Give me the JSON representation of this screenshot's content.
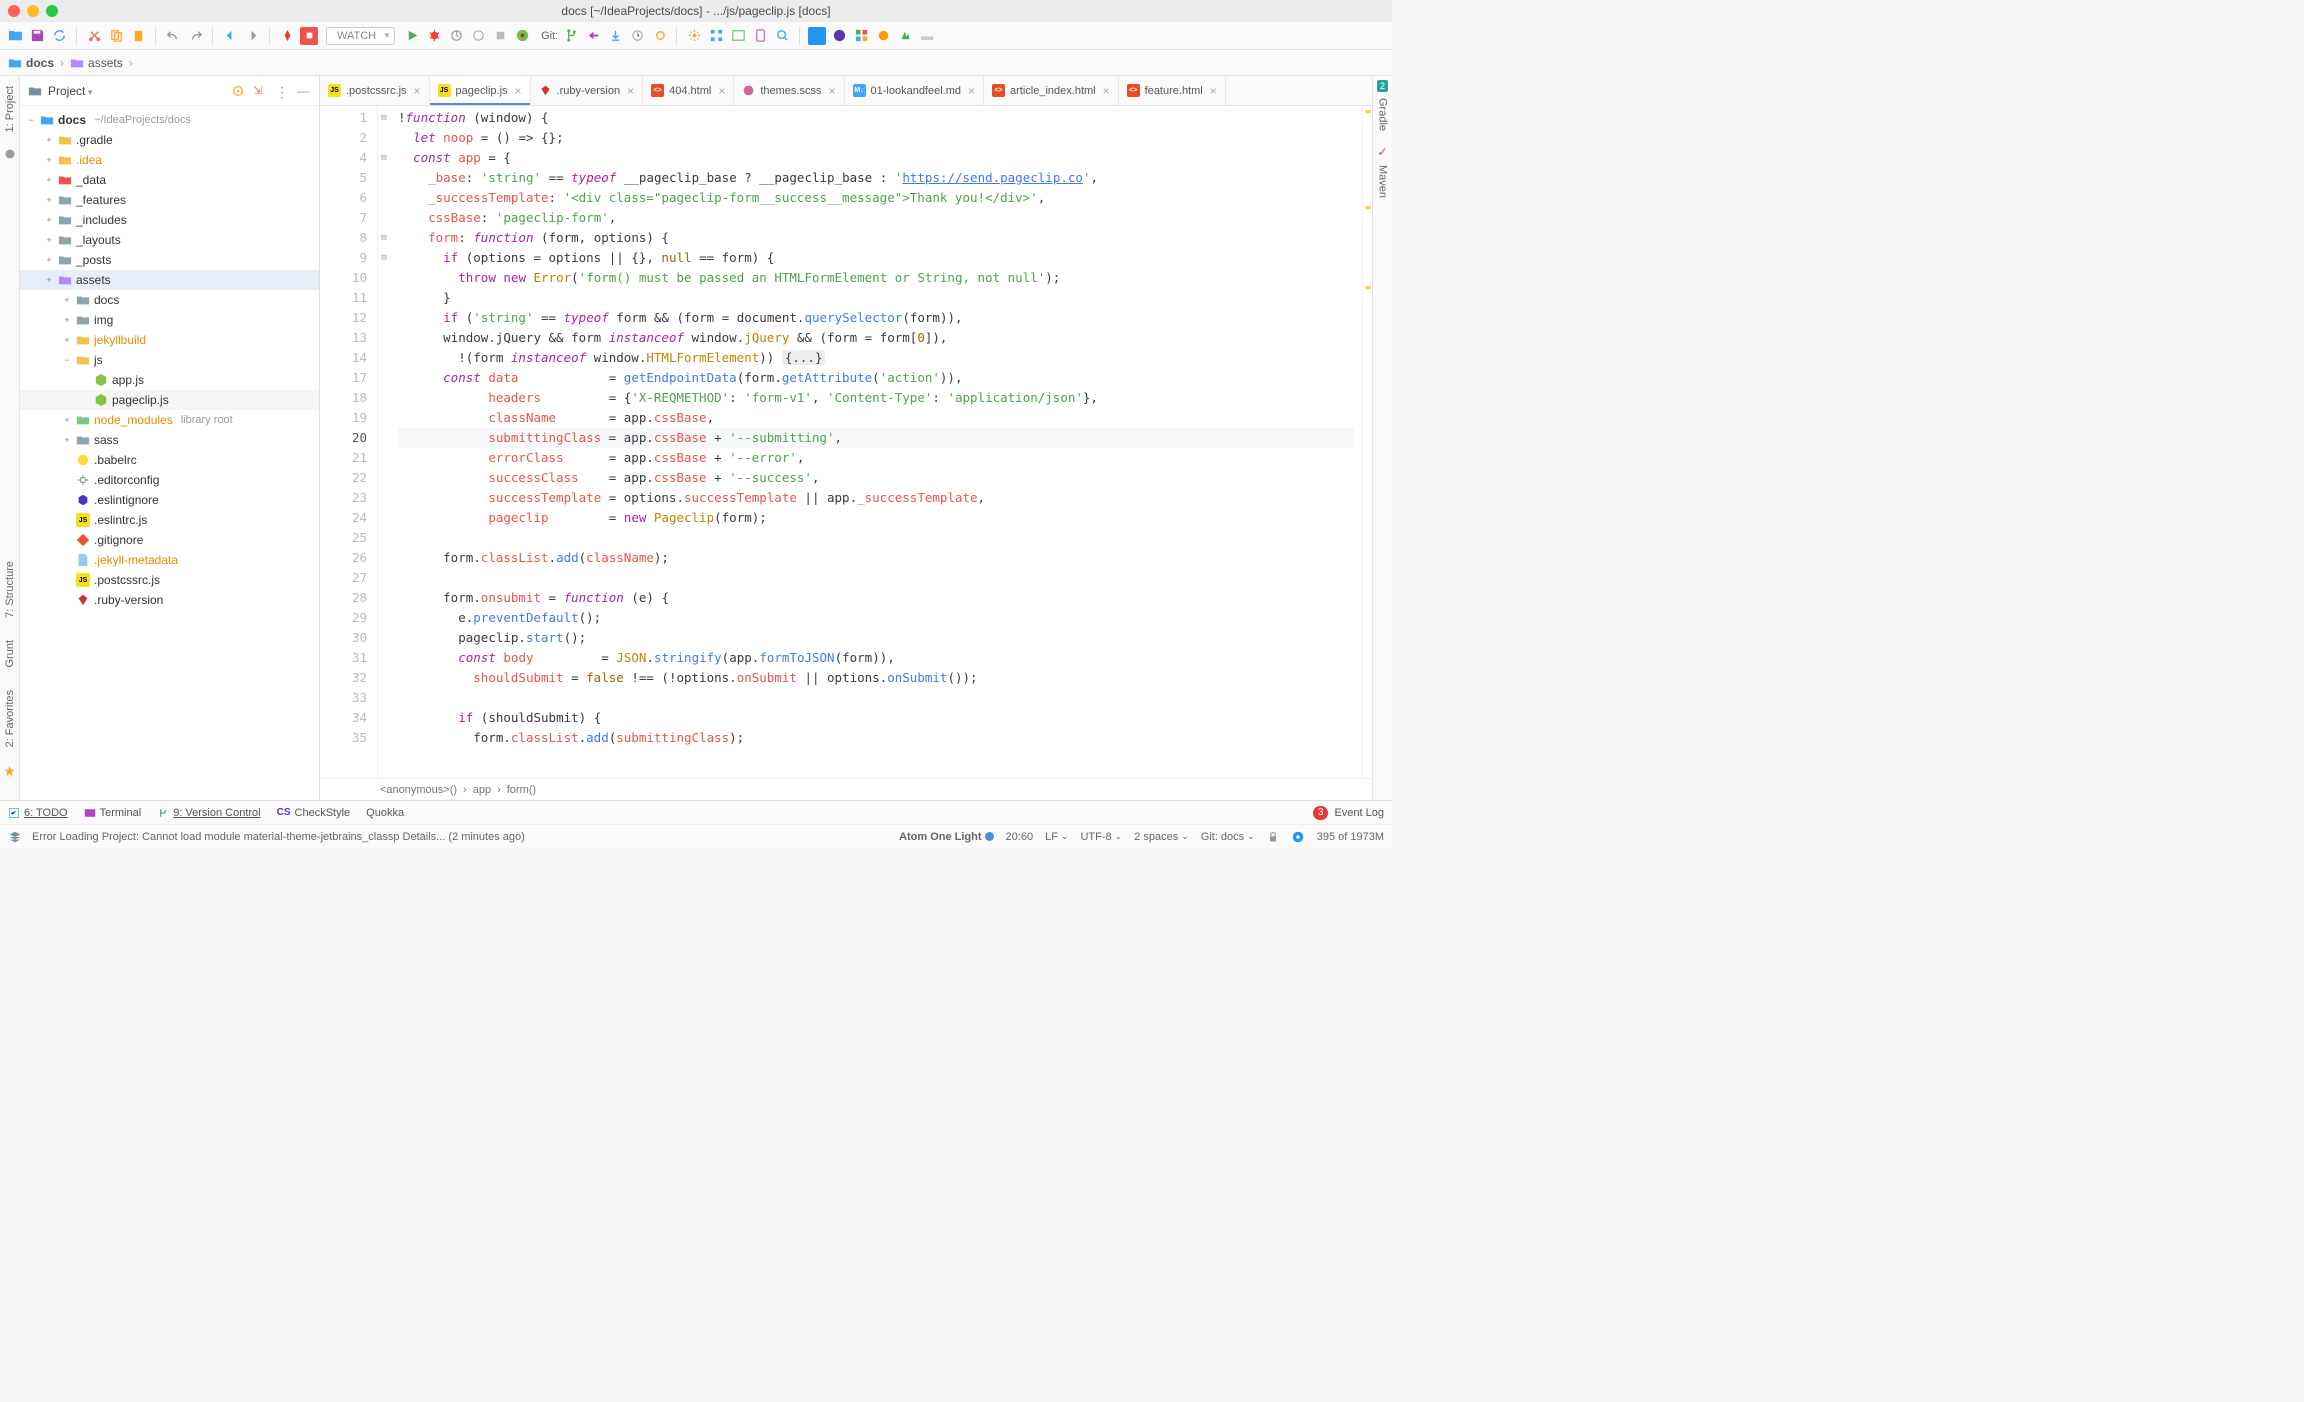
{
  "title": "docs [~/IdeaProjects/docs] - .../js/pageclip.js [docs]",
  "watch_label": "WATCH",
  "git_label": "Git:",
  "breadcrumb": [
    {
      "icon": "folder",
      "label": "docs"
    },
    {
      "icon": "folder-p",
      "label": "assets"
    }
  ],
  "sidebar": {
    "title": "Project",
    "root": {
      "label": "docs",
      "hint": "~/IdeaProjects/docs"
    },
    "items": [
      {
        "indent": 1,
        "arrow": "+",
        "ico": "folder-y",
        "label": ".gradle"
      },
      {
        "indent": 1,
        "arrow": "+",
        "ico": "folder-y",
        "label": ".idea",
        "orange": true
      },
      {
        "indent": 1,
        "arrow": "+",
        "ico": "folder-r",
        "label": "_data"
      },
      {
        "indent": 1,
        "arrow": "+",
        "ico": "folder",
        "label": "_features"
      },
      {
        "indent": 1,
        "arrow": "+",
        "ico": "folder",
        "label": "_includes"
      },
      {
        "indent": 1,
        "arrow": "+",
        "ico": "folder",
        "label": "_layouts"
      },
      {
        "indent": 1,
        "arrow": "+",
        "ico": "folder",
        "label": "_posts"
      },
      {
        "indent": 1,
        "arrow": "+",
        "ico": "folder-p",
        "label": "assets",
        "sel": true
      },
      {
        "indent": 2,
        "arrow": "+",
        "ico": "folder",
        "label": "docs"
      },
      {
        "indent": 2,
        "arrow": "+",
        "ico": "folder",
        "label": "img"
      },
      {
        "indent": 2,
        "arrow": "+",
        "ico": "folder-y",
        "label": "jekyllbuild",
        "orange": true
      },
      {
        "indent": 2,
        "arrow": "−",
        "ico": "folder-y",
        "label": "js"
      },
      {
        "indent": 3,
        "arrow": "",
        "ico": "node",
        "label": "app.js"
      },
      {
        "indent": 3,
        "arrow": "",
        "ico": "node",
        "label": "pageclip.js",
        "sel2": true
      },
      {
        "indent": 2,
        "arrow": "+",
        "ico": "folder-g",
        "label": "node_modules",
        "hint": "library root",
        "orange": true
      },
      {
        "indent": 2,
        "arrow": "+",
        "ico": "folder",
        "label": "sass"
      },
      {
        "indent": 2,
        "arrow": "",
        "ico": "babel",
        "label": ".babelrc"
      },
      {
        "indent": 2,
        "arrow": "",
        "ico": "gear",
        "label": ".editorconfig"
      },
      {
        "indent": 2,
        "arrow": "",
        "ico": "eslint",
        "label": ".eslintignore"
      },
      {
        "indent": 2,
        "arrow": "",
        "ico": "js",
        "label": ".eslintrc.js"
      },
      {
        "indent": 2,
        "arrow": "",
        "ico": "git",
        "label": ".gitignore"
      },
      {
        "indent": 2,
        "arrow": "",
        "ico": "file",
        "label": ".jekyll-metadata",
        "orange": true
      },
      {
        "indent": 2,
        "arrow": "",
        "ico": "js",
        "label": ".postcssrc.js"
      },
      {
        "indent": 2,
        "arrow": "",
        "ico": "ruby",
        "label": ".ruby-version"
      }
    ]
  },
  "tabs": [
    {
      "ico": "js",
      "label": ".postcssrc.js"
    },
    {
      "ico": "js",
      "label": "pageclip.js",
      "active": true
    },
    {
      "ico": "ruby",
      "label": ".ruby-version"
    },
    {
      "ico": "html",
      "label": "404.html"
    },
    {
      "ico": "sass",
      "label": "themes.scss"
    },
    {
      "ico": "md",
      "label": "01-lookandfeel.md"
    },
    {
      "ico": "html",
      "label": "article_index.html"
    },
    {
      "ico": "html",
      "label": "feature.html"
    }
  ],
  "code": {
    "lines": [
      1,
      2,
      4,
      5,
      6,
      7,
      8,
      9,
      10,
      11,
      12,
      13,
      14,
      17,
      18,
      19,
      20,
      21,
      22,
      23,
      24,
      25,
      26,
      27,
      28,
      29,
      30,
      31,
      32,
      33,
      34,
      35
    ],
    "current": 20
  },
  "code_crumb": [
    "<anonymous>()",
    "app",
    "form()"
  ],
  "left_rail": [
    {
      "label": "1: Project"
    },
    {
      "label": "7: Structure"
    },
    {
      "label": "Grunt"
    },
    {
      "label": "2: Favorites"
    }
  ],
  "right_rail": [
    {
      "label": "Gradle"
    },
    {
      "label": "Maven"
    }
  ],
  "bottom": {
    "todo": "6: TODO",
    "terminal": "Terminal",
    "vcs": "9: Version Control",
    "checkstyle": "CheckStyle",
    "quokka": "Quokka",
    "eventlog": "Event Log",
    "badge": "3"
  },
  "status": {
    "msg": "Error Loading Project: Cannot load module material-theme-jetbrains_classp Details... (2 minutes ago)",
    "theme": "Atom One Light",
    "pos": "20:60",
    "le": "LF",
    "enc": "UTF-8",
    "indent": "2 spaces",
    "git": "Git: docs",
    "mem": "395 of 1973M"
  }
}
